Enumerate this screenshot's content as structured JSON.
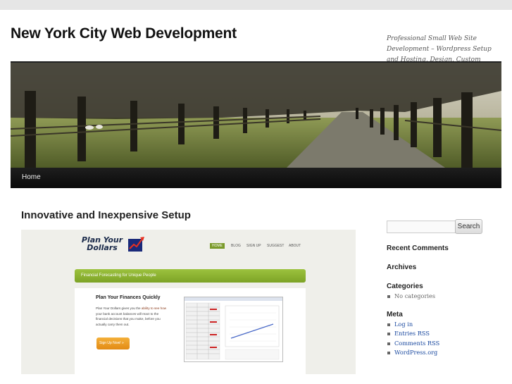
{
  "site": {
    "title": "New York City Web Development",
    "tagline": "Professional Small Web Site Development – Wordpress Setup and Hosting, Design, Custom Coding"
  },
  "nav": {
    "items": [
      {
        "label": "Home"
      }
    ]
  },
  "post": {
    "title": "Innovative and Inexpensive Setup"
  },
  "embedded_screenshot": {
    "logo_line1": "Plan Your",
    "logo_line2": "Dollars",
    "nav": [
      "HOME",
      "BLOG",
      "SIGN UP",
      "SUGGEST",
      "ABOUT"
    ],
    "banner": "Financial Forecasting for Unique People",
    "heading": "Plan Your Finances Quickly",
    "body_1": "Plan Your Dollars gives you the",
    "body_1b": "ability to see how",
    "body_2": "your bank account balances will react to the",
    "body_3": "financial decisions that you make, before you",
    "body_4": "actually carry them out.",
    "signup_label": "Sign Up Now! »",
    "prev_icon": "‹",
    "next_icon": "›"
  },
  "sidebar": {
    "search": {
      "placeholder": "",
      "button_label": "Search"
    },
    "recent_comments_title": "Recent Comments",
    "archives_title": "Archives",
    "categories_title": "Categories",
    "categories": [
      "No categories"
    ],
    "meta_title": "Meta",
    "meta_links": [
      "Log in",
      "Entries RSS",
      "Comments RSS",
      "WordPress.org"
    ]
  },
  "colors": {
    "link": "#1b4aa0",
    "nav_bg": "#111111",
    "banner_green": "#8ab530",
    "signup_orange": "#ee9a20"
  }
}
